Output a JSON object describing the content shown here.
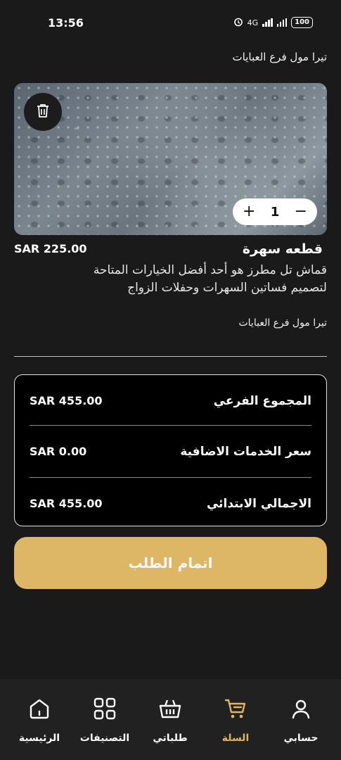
{
  "status_bar": {
    "time": "13:56",
    "network": "4G",
    "battery": "100"
  },
  "cart_item": {
    "top_vendor_partial": "تيرا مول فرع العبايات",
    "title": "قطعه سهرة",
    "price": "SAR 225.00",
    "description": "قماش تل مطرز هو أحد أفضل الخيارات المتاحة لتصميم فساتين السهرات وحفلات الزواج",
    "vendor": "تيرا مول فرع العبايات",
    "quantity": "1",
    "plus_symbol": "+",
    "minus_symbol": "−",
    "delete_icon": "trash-icon"
  },
  "summary": {
    "subtotal_label": "المجموع الفرعي",
    "subtotal_value": "SAR 455.00",
    "extra_services_label": "سعر الخدمات الاضافية",
    "extra_services_value": "SAR 0.00",
    "initial_total_label": "الاجمالي الابتدائي",
    "initial_total_value": "SAR 455.00"
  },
  "checkout": {
    "label": "اتمام الطلب",
    "color": "#deb766"
  },
  "bottom_nav": {
    "active_color": "#deb766",
    "items": [
      {
        "label": "الرئيسية",
        "icon": "home-icon",
        "active": false
      },
      {
        "label": "التصنيفات",
        "icon": "grid-icon",
        "active": false
      },
      {
        "label": "طلباتي",
        "icon": "basket-icon",
        "active": false
      },
      {
        "label": "السلة",
        "icon": "cart-icon",
        "active": true
      },
      {
        "label": "حسابي",
        "icon": "user-icon",
        "active": false
      }
    ]
  }
}
